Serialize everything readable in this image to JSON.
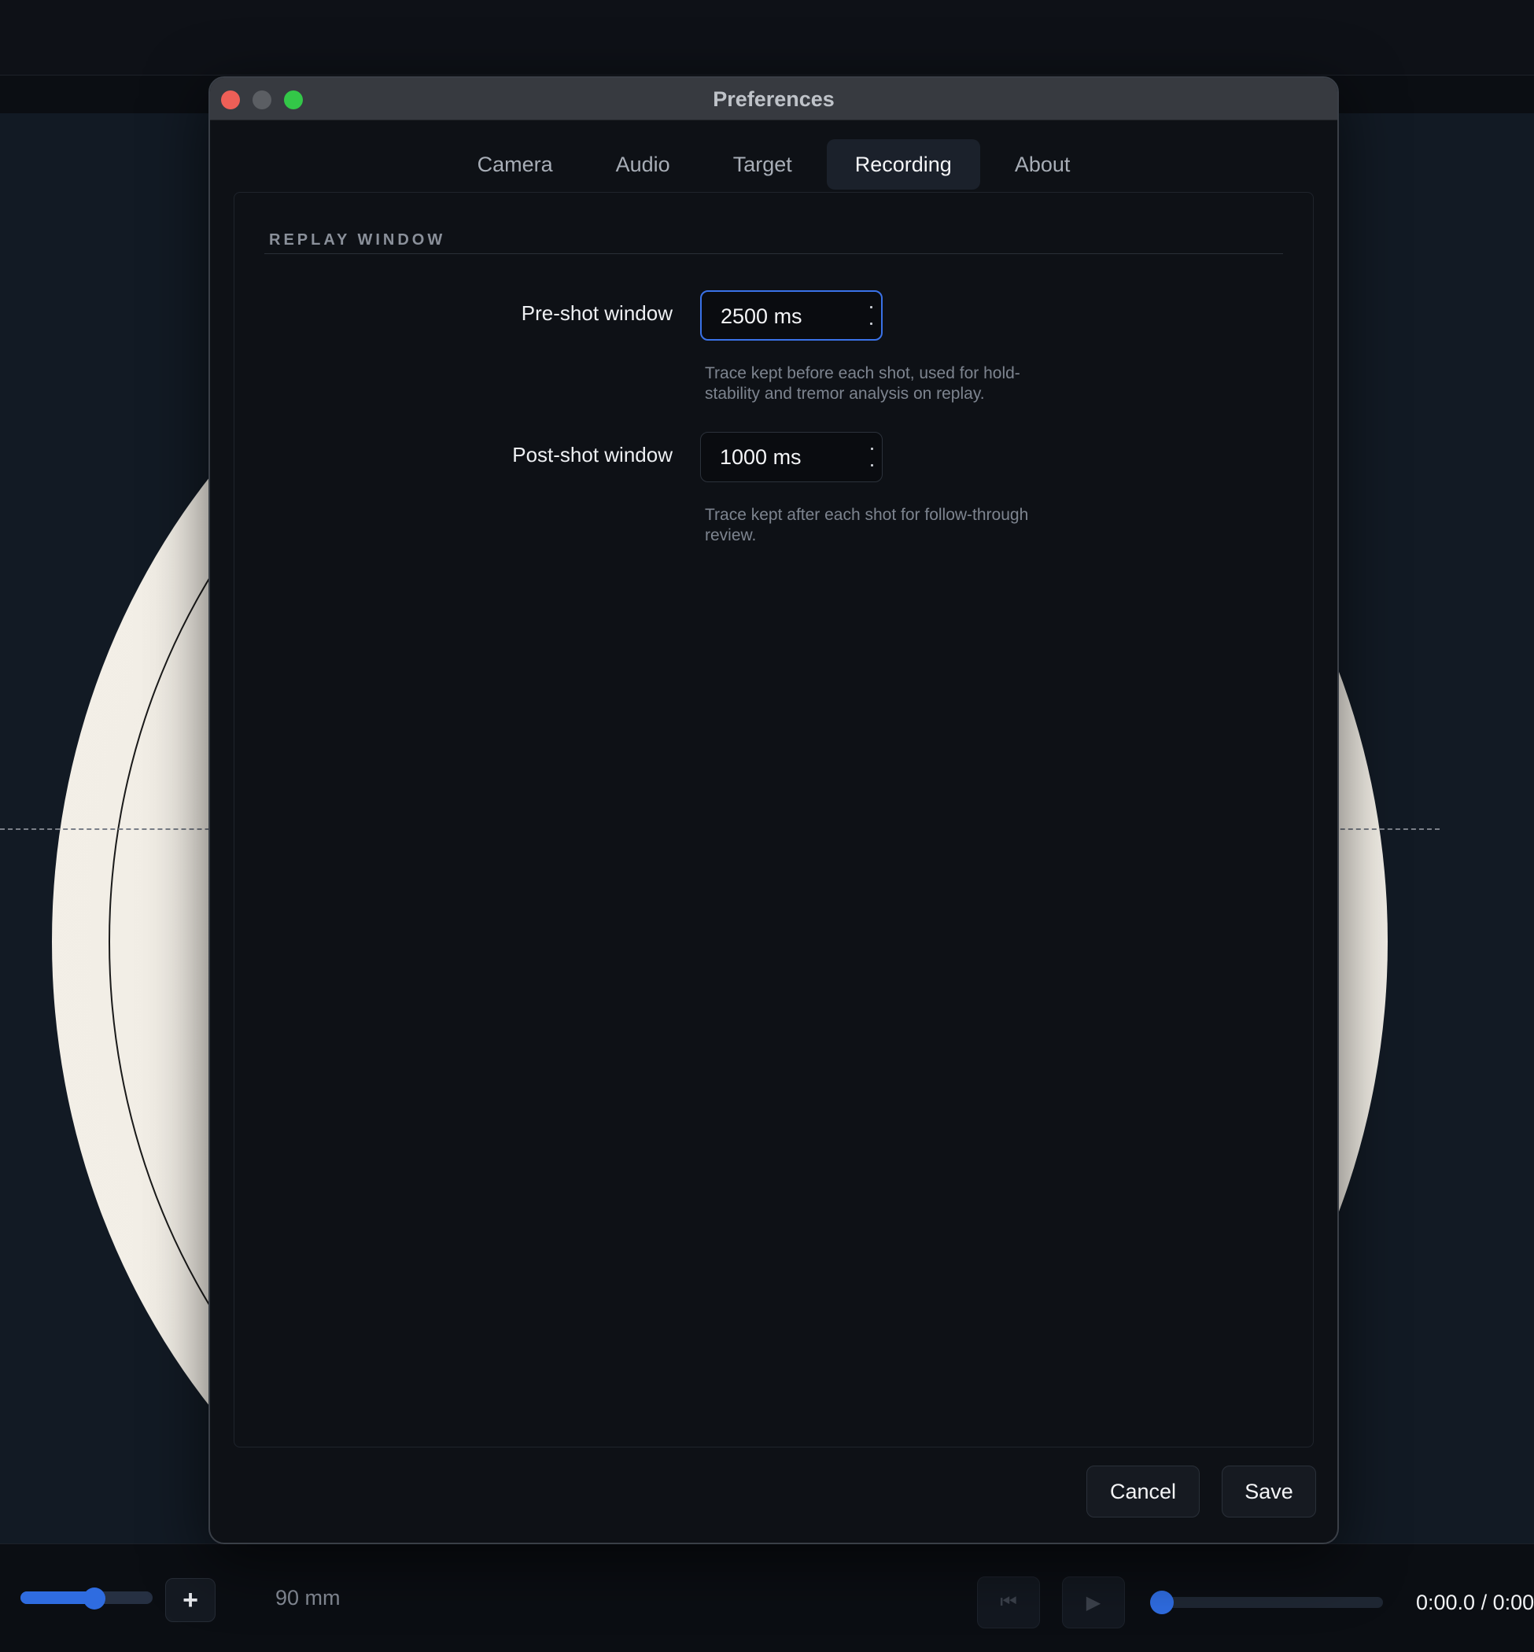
{
  "dialog": {
    "title": "Preferences",
    "tabs": [
      {
        "label": "Camera"
      },
      {
        "label": "Audio"
      },
      {
        "label": "Target"
      },
      {
        "label": "Recording",
        "active": true
      },
      {
        "label": "About"
      }
    ],
    "section_title": "REPLAY WINDOW",
    "fields": {
      "pre_shot": {
        "label": "Pre-shot window",
        "value": "2500 ms",
        "help": "Trace kept before each shot, used for hold-stability and tremor analysis on replay."
      },
      "post_shot": {
        "label": "Post-shot window",
        "value": "1000 ms",
        "help": "Trace kept after each shot for follow-through review."
      }
    },
    "buttons": {
      "cancel": "Cancel",
      "save": "Save"
    }
  },
  "toolbar": {
    "zoom_level_fraction": 0.56,
    "plus_label": "+",
    "target_size": "90 mm",
    "skip_back_icon": "skip-back-icon",
    "play_icon": "play-icon",
    "playback_position_fraction": 0.0,
    "time": "0:00.0 / 0:00"
  },
  "colors": {
    "accent": "#2f6ce0",
    "close": "#ee5f57",
    "zoom": "#33c748",
    "target_face": "#f4f0e8"
  }
}
